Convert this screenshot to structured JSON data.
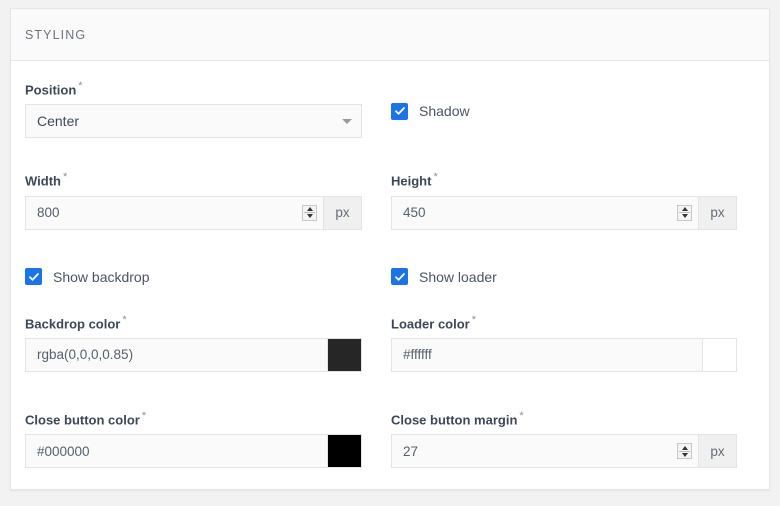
{
  "card": {
    "header_title": "STYLING"
  },
  "fields": {
    "position": {
      "label": "Position",
      "required_marker": "*",
      "value": "Center",
      "arrow_icon": "chevron-down-icon"
    },
    "shadow": {
      "label": "Shadow",
      "checked": true
    },
    "width": {
      "label": "Width",
      "required_marker": "*",
      "value": "800",
      "unit": "px"
    },
    "height": {
      "label": "Height",
      "required_marker": "*",
      "value": "450",
      "unit": "px"
    },
    "show_backdrop": {
      "label": "Show backdrop",
      "checked": true
    },
    "show_loader": {
      "label": "Show loader",
      "checked": true
    },
    "backdrop_color": {
      "label": "Backdrop color",
      "required_marker": "*",
      "value": "rgba(0,0,0,0.85)",
      "swatch_color": "#262626"
    },
    "loader_color": {
      "label": "Loader color",
      "required_marker": "*",
      "value": "#ffffff",
      "swatch_color": "#ffffff"
    },
    "close_button_color": {
      "label": "Close button color",
      "required_marker": "*",
      "value": "#000000",
      "swatch_color": "#000000"
    },
    "close_button_margin": {
      "label": "Close button margin",
      "required_marker": "*",
      "value": "27",
      "unit": "px"
    }
  },
  "colors": {
    "accent": "#1a73e8",
    "card_background": "#ffffff",
    "header_background": "#fafafa",
    "page_background": "#f2f2f2",
    "input_background": "#fafafa",
    "label_text": "#3c4858"
  }
}
